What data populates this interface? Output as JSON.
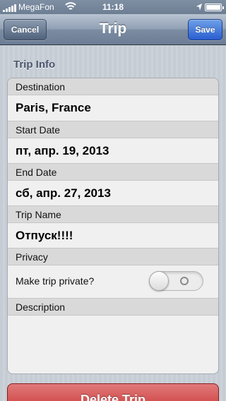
{
  "statusbar": {
    "carrier": "MegaFon",
    "time": "11:18"
  },
  "navbar": {
    "title": "Trip",
    "cancel_label": "Cancel",
    "save_label": "Save"
  },
  "form": {
    "section_header": "Trip Info",
    "destination_label": "Destination",
    "destination_value": "Paris, France",
    "start_date_label": "Start Date",
    "start_date_value": "пт, апр. 19, 2013",
    "end_date_label": "End Date",
    "end_date_value": "сб, апр. 27, 2013",
    "trip_name_label": "Trip Name",
    "trip_name_value": "Отпуск!!!!",
    "privacy_label": "Privacy",
    "private_toggle_label": "Make trip private?",
    "private_toggle_on": false,
    "description_label": "Description",
    "description_value": ""
  },
  "actions": {
    "delete_label": "Delete Trip"
  },
  "colors": {
    "navbar": "#7b8ca3",
    "save_button": "#2a5ed0",
    "delete_button": "#c92e2e"
  }
}
